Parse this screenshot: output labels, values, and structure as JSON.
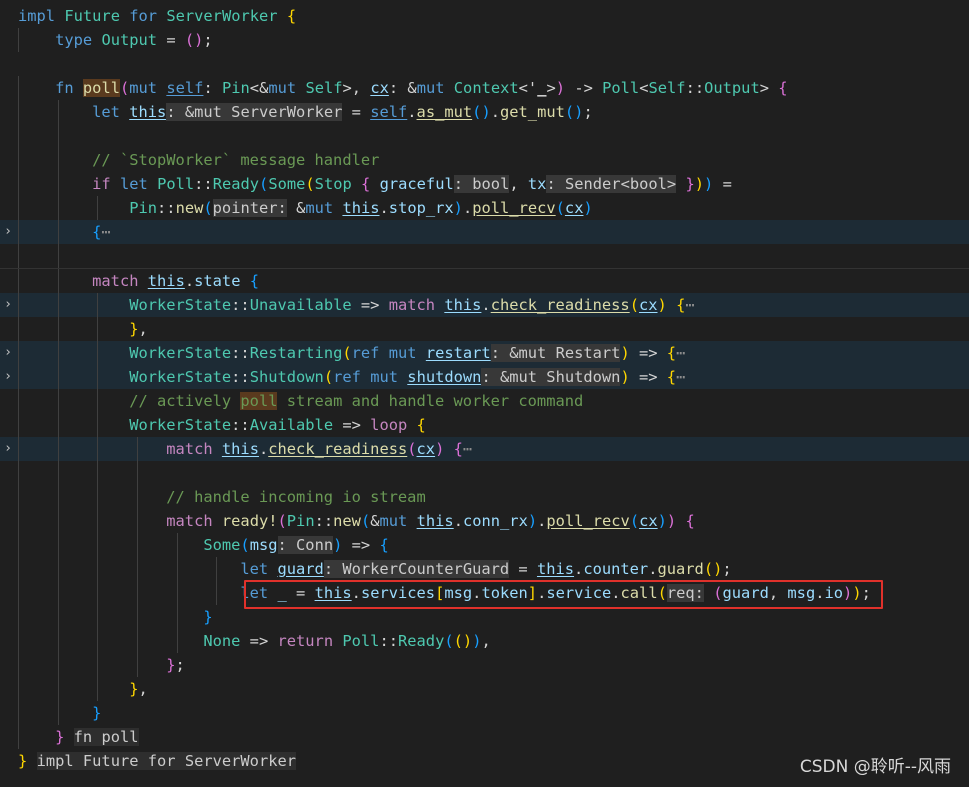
{
  "editor": {
    "colors": {
      "background": "#1f1f1f",
      "keyword": "#569cd6",
      "control": "#c586c0",
      "type": "#4ec9b0",
      "function": "#dcdcaa",
      "variable": "#9cdcfe",
      "comment": "#6a9955",
      "highlight_box": "#e0312b"
    },
    "fold_icon": "chevron-right-icon",
    "highlighted_line_index": 24,
    "lines": [
      {
        "indent": 0,
        "tokens": [
          [
            "impl",
            "kw"
          ],
          [
            " "
          ],
          [
            "Future",
            "ty"
          ],
          [
            " "
          ],
          [
            "for",
            "kw"
          ],
          [
            " "
          ],
          [
            "ServerWorker",
            "ty"
          ],
          [
            " "
          ],
          [
            "{",
            "b1"
          ]
        ]
      },
      {
        "indent": 1,
        "tokens": [
          [
            "type",
            "kw"
          ],
          [
            " "
          ],
          [
            "Output",
            "ty"
          ],
          [
            " = "
          ],
          [
            "(",
            "b2"
          ],
          [
            ")",
            "b2"
          ],
          [
            ";"
          ]
        ]
      },
      {
        "indent": 0,
        "tokens": []
      },
      {
        "indent": 1,
        "tokens": [
          [
            "fn",
            "kw"
          ],
          [
            " "
          ],
          [
            "poll",
            "fn hl"
          ],
          [
            "(",
            "b2"
          ],
          [
            "mut",
            "kw"
          ],
          [
            " "
          ],
          [
            "self",
            "self u"
          ],
          [
            ": "
          ],
          [
            "Pin",
            "ty"
          ],
          [
            "<&"
          ],
          [
            "mut",
            "kw"
          ],
          [
            " "
          ],
          [
            "Self",
            "ty"
          ],
          [
            ">, "
          ],
          [
            "cx",
            "var u"
          ],
          [
            ": &"
          ],
          [
            "mut",
            "kw"
          ],
          [
            " "
          ],
          [
            "Context",
            "ty"
          ],
          [
            "<'"
          ],
          [
            "_",
            "u"
          ],
          [
            ">"
          ],
          [
            ")",
            "b2"
          ],
          [
            " -> "
          ],
          [
            "Poll",
            "ty"
          ],
          [
            "<"
          ],
          [
            "Self",
            "ty"
          ],
          [
            "::"
          ],
          [
            "Output",
            "ty"
          ],
          [
            "> "
          ],
          [
            "{",
            "b2"
          ]
        ]
      },
      {
        "indent": 2,
        "tokens": [
          [
            "let",
            "kw"
          ],
          [
            " "
          ],
          [
            "this",
            "var u"
          ],
          [
            ": &mut ServerWorker",
            "hint"
          ],
          [
            " = "
          ],
          [
            "self",
            "self u"
          ],
          [
            "."
          ],
          [
            "as_mut",
            "fn u"
          ],
          [
            "(",
            "b3"
          ],
          [
            ")",
            "b3"
          ],
          [
            "."
          ],
          [
            "get_mut",
            "fn"
          ],
          [
            "(",
            "b3"
          ],
          [
            ")",
            "b3"
          ],
          [
            ";"
          ]
        ]
      },
      {
        "indent": 2,
        "tokens": []
      },
      {
        "indent": 2,
        "tokens": [
          [
            "// `StopWorker` message handler",
            "cm"
          ]
        ]
      },
      {
        "indent": 2,
        "tokens": [
          [
            "if",
            "ctl"
          ],
          [
            " "
          ],
          [
            "let",
            "kw"
          ],
          [
            " "
          ],
          [
            "Poll",
            "ty"
          ],
          [
            "::"
          ],
          [
            "Ready",
            "ty"
          ],
          [
            "(",
            "b3"
          ],
          [
            "Some",
            "ty"
          ],
          [
            "(",
            "b1"
          ],
          [
            "Stop",
            "ty"
          ],
          [
            " "
          ],
          [
            "{",
            "b2"
          ],
          [
            " "
          ],
          [
            "graceful",
            "var"
          ],
          [
            ": bool",
            "hint"
          ],
          [
            ", "
          ],
          [
            "tx",
            "var"
          ],
          [
            ": Sender<bool>",
            "hint"
          ],
          [
            " "
          ],
          [
            "}",
            "b2"
          ],
          [
            ")",
            "b1"
          ],
          [
            ")",
            "b3"
          ],
          [
            " ="
          ]
        ]
      },
      {
        "indent": 3,
        "tokens": [
          [
            "Pin",
            "ty"
          ],
          [
            "::"
          ],
          [
            "new",
            "fn"
          ],
          [
            "(",
            "b3"
          ],
          [
            "pointer:",
            "hint"
          ],
          [
            " &"
          ],
          [
            "mut",
            "kw"
          ],
          [
            " "
          ],
          [
            "this",
            "var u"
          ],
          [
            "."
          ],
          [
            "stop_rx",
            "var"
          ],
          [
            ")",
            "b3"
          ],
          [
            "."
          ],
          [
            "poll_recv",
            "fn u"
          ],
          [
            "(",
            "b3"
          ],
          [
            "cx",
            "var u"
          ],
          [
            ")",
            "b3"
          ]
        ]
      },
      {
        "indent": 2,
        "folded": true,
        "tokens": [
          [
            "{",
            "b3"
          ],
          [
            "⋯",
            "ell"
          ]
        ]
      },
      {
        "indent": 2,
        "sep": true,
        "tokens": []
      },
      {
        "indent": 2,
        "tokens": [
          [
            "match",
            "ctl"
          ],
          [
            " "
          ],
          [
            "this",
            "var u"
          ],
          [
            "."
          ],
          [
            "state",
            "var"
          ],
          [
            " "
          ],
          [
            "{",
            "b3"
          ]
        ]
      },
      {
        "indent": 3,
        "folded": true,
        "tokens": [
          [
            "WorkerState",
            "ty"
          ],
          [
            "::"
          ],
          [
            "Unavailable",
            "ty"
          ],
          [
            " => "
          ],
          [
            "match",
            "ctl"
          ],
          [
            " "
          ],
          [
            "this",
            "var u"
          ],
          [
            "."
          ],
          [
            "check_readiness",
            "fn u"
          ],
          [
            "(",
            "b1"
          ],
          [
            "cx",
            "var u"
          ],
          [
            ")",
            "b1"
          ],
          [
            " "
          ],
          [
            "{",
            "b1"
          ],
          [
            "⋯",
            "ell"
          ]
        ]
      },
      {
        "indent": 3,
        "tokens": [
          [
            "}",
            "b1"
          ],
          [
            ","
          ]
        ]
      },
      {
        "indent": 3,
        "folded": true,
        "tokens": [
          [
            "WorkerState",
            "ty"
          ],
          [
            "::"
          ],
          [
            "Restarting",
            "ty"
          ],
          [
            "(",
            "b1"
          ],
          [
            "ref",
            "kw"
          ],
          [
            " "
          ],
          [
            "mut",
            "kw"
          ],
          [
            " "
          ],
          [
            "restart",
            "var u"
          ],
          [
            ": &mut Restart",
            "hint"
          ],
          [
            ")",
            "b1"
          ],
          [
            " => "
          ],
          [
            "{",
            "b1"
          ],
          [
            "⋯",
            "ell"
          ]
        ]
      },
      {
        "indent": 3,
        "folded": true,
        "tokens": [
          [
            "WorkerState",
            "ty"
          ],
          [
            "::"
          ],
          [
            "Shutdown",
            "ty"
          ],
          [
            "(",
            "b1"
          ],
          [
            "ref",
            "kw"
          ],
          [
            " "
          ],
          [
            "mut",
            "kw"
          ],
          [
            " "
          ],
          [
            "shutdown",
            "var u"
          ],
          [
            ": &mut Shutdown",
            "hint"
          ],
          [
            ")",
            "b1"
          ],
          [
            " => "
          ],
          [
            "{",
            "b1"
          ],
          [
            "⋯",
            "ell"
          ]
        ]
      },
      {
        "indent": 3,
        "tokens": [
          [
            "// actively ",
            "cm"
          ],
          [
            "poll",
            "cm hl"
          ],
          [
            " stream and handle worker command",
            "cm"
          ]
        ]
      },
      {
        "indent": 3,
        "tokens": [
          [
            "WorkerState",
            "ty"
          ],
          [
            "::"
          ],
          [
            "Available",
            "ty"
          ],
          [
            " => "
          ],
          [
            "loop",
            "ctl"
          ],
          [
            " "
          ],
          [
            "{",
            "b1"
          ]
        ]
      },
      {
        "indent": 4,
        "folded": true,
        "tokens": [
          [
            "match",
            "ctl"
          ],
          [
            " "
          ],
          [
            "this",
            "var u"
          ],
          [
            "."
          ],
          [
            "check_readiness",
            "fn u"
          ],
          [
            "(",
            "b2"
          ],
          [
            "cx",
            "var u"
          ],
          [
            ")",
            "b2"
          ],
          [
            " "
          ],
          [
            "{",
            "b2"
          ],
          [
            "⋯",
            "ell"
          ]
        ]
      },
      {
        "indent": 4,
        "tokens": []
      },
      {
        "indent": 4,
        "tokens": [
          [
            "// handle incoming io stream",
            "cm"
          ]
        ]
      },
      {
        "indent": 4,
        "tokens": [
          [
            "match",
            "ctl"
          ],
          [
            " "
          ],
          [
            "ready!",
            "fn"
          ],
          [
            "(",
            "b2"
          ],
          [
            "Pin",
            "ty"
          ],
          [
            "::"
          ],
          [
            "new",
            "fn"
          ],
          [
            "(",
            "b3"
          ],
          [
            "&"
          ],
          [
            "mut",
            "kw"
          ],
          [
            " "
          ],
          [
            "this",
            "var u"
          ],
          [
            "."
          ],
          [
            "conn_rx",
            "var"
          ],
          [
            ")",
            "b3"
          ],
          [
            "."
          ],
          [
            "poll_recv",
            "fn u"
          ],
          [
            "(",
            "b3"
          ],
          [
            "cx",
            "var u"
          ],
          [
            ")",
            "b3"
          ],
          [
            ")",
            "b2"
          ],
          [
            " "
          ],
          [
            "{",
            "b2"
          ]
        ]
      },
      {
        "indent": 5,
        "tokens": [
          [
            "Some",
            "ty"
          ],
          [
            "(",
            "b3"
          ],
          [
            "msg",
            "var"
          ],
          [
            ": Conn",
            "hint"
          ],
          [
            ")",
            "b3"
          ],
          [
            " => "
          ],
          [
            "{",
            "b3"
          ]
        ]
      },
      {
        "indent": 6,
        "tokens": [
          [
            "let",
            "kw"
          ],
          [
            " "
          ],
          [
            "guard",
            "var u"
          ],
          [
            ": WorkerCounterGuard",
            "hint"
          ],
          [
            " = "
          ],
          [
            "this",
            "var u"
          ],
          [
            "."
          ],
          [
            "counter",
            "var"
          ],
          [
            "."
          ],
          [
            "guard",
            "fn"
          ],
          [
            "(",
            "b1"
          ],
          [
            ")",
            "b1"
          ],
          [
            ";"
          ]
        ]
      },
      {
        "indent": 6,
        "tokens": [
          [
            "let",
            "kw"
          ],
          [
            " "
          ],
          [
            "_",
            "var"
          ],
          [
            " = "
          ],
          [
            "this",
            "var u"
          ],
          [
            "."
          ],
          [
            "services",
            "var"
          ],
          [
            "[",
            "b1"
          ],
          [
            "msg",
            "var"
          ],
          [
            "."
          ],
          [
            "token",
            "var"
          ],
          [
            "]",
            "b1"
          ],
          [
            "."
          ],
          [
            "service",
            "var"
          ],
          [
            "."
          ],
          [
            "call",
            "fn"
          ],
          [
            "(",
            "b1"
          ],
          [
            "req:",
            "hint"
          ],
          [
            " "
          ],
          [
            "(",
            "b2"
          ],
          [
            "guard",
            "var"
          ],
          [
            ", "
          ],
          [
            "msg",
            "var"
          ],
          [
            "."
          ],
          [
            "io",
            "var"
          ],
          [
            ")",
            "b2"
          ],
          [
            ")",
            "b1"
          ],
          [
            ";"
          ]
        ]
      },
      {
        "indent": 5,
        "tokens": [
          [
            "}",
            "b3"
          ]
        ]
      },
      {
        "indent": 5,
        "tokens": [
          [
            "None",
            "ty"
          ],
          [
            " => "
          ],
          [
            "return",
            "ctl"
          ],
          [
            " "
          ],
          [
            "Poll",
            "ty"
          ],
          [
            "::"
          ],
          [
            "Ready",
            "ty"
          ],
          [
            "(",
            "b3"
          ],
          [
            "(",
            "b1"
          ],
          [
            ")",
            "b1"
          ],
          [
            ")",
            "b3"
          ],
          [
            ","
          ]
        ]
      },
      {
        "indent": 4,
        "tokens": [
          [
            "}",
            "b2"
          ],
          [
            ";"
          ]
        ]
      },
      {
        "indent": 3,
        "tokens": [
          [
            "}",
            "b1"
          ],
          [
            ","
          ]
        ]
      },
      {
        "indent": 2,
        "tokens": [
          [
            "}",
            "b3"
          ]
        ]
      },
      {
        "indent": 1,
        "tokens": [
          [
            "}",
            "b2"
          ],
          [
            " "
          ],
          [
            "fn poll",
            "endtag"
          ]
        ]
      },
      {
        "indent": 0,
        "tokens": [
          [
            "}",
            "b1"
          ],
          [
            " "
          ],
          [
            "impl Future for ServerWorker",
            "endtag"
          ]
        ]
      }
    ]
  },
  "watermark": "CSDN @聆听--风雨"
}
